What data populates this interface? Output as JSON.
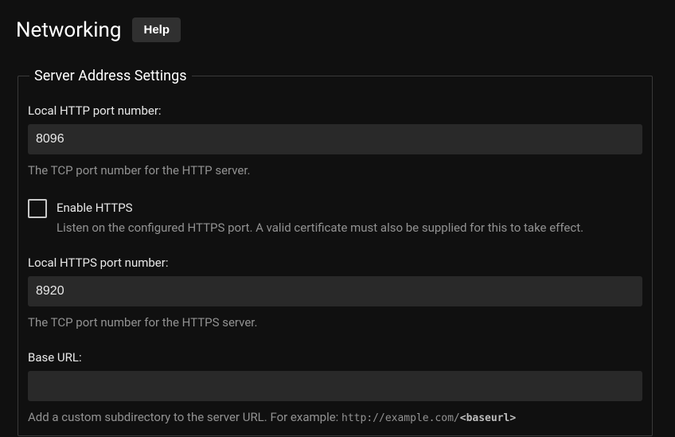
{
  "header": {
    "title": "Networking",
    "help_label": "Help"
  },
  "group": {
    "legend": "Server Address Settings",
    "http_port": {
      "label": "Local HTTP port number:",
      "value": "8096",
      "desc": "The TCP port number for the HTTP server."
    },
    "enable_https": {
      "label": "Enable HTTPS",
      "checked": false,
      "desc": "Listen on the configured HTTPS port. A valid certificate must also be supplied for this to take effect."
    },
    "https_port": {
      "label": "Local HTTPS port number:",
      "value": "8920",
      "desc": "The TCP port number for the HTTPS server."
    },
    "base_url": {
      "label": "Base URL:",
      "value": "",
      "desc_prefix": "Add a custom subdirectory to the server URL. For example: ",
      "desc_code_plain": "http://example.com/",
      "desc_code_bold": "<baseurl>"
    }
  }
}
